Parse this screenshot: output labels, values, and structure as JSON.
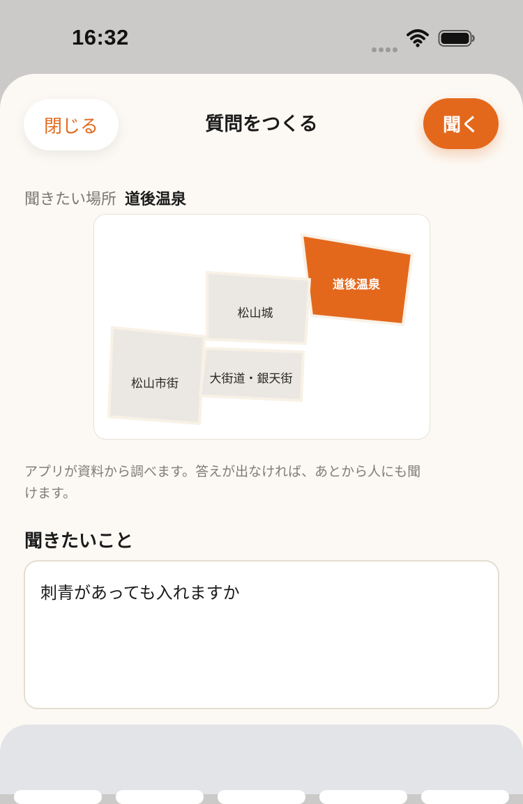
{
  "status": {
    "time": "16:32"
  },
  "header": {
    "close_label": "閉じる",
    "title": "質問をつくる",
    "ask_label": "聞く"
  },
  "place": {
    "label": "聞きたい場所",
    "value": "道後温泉"
  },
  "map": {
    "areas": [
      {
        "id": "dogo",
        "label": "道後温泉",
        "selected": true
      },
      {
        "id": "castle",
        "label": "松山城",
        "selected": false
      },
      {
        "id": "city",
        "label": "松山市街",
        "selected": false
      },
      {
        "id": "okaido",
        "label": "大街道・銀天街",
        "selected": false
      }
    ],
    "colors": {
      "selected": "#e4681c",
      "default": "#ebe8e3",
      "border": "#f8f1e6"
    }
  },
  "helper_text": "アプリが資料から調べます。答えが出なければ、あとから人にも聞けます。",
  "question": {
    "heading": "聞きたいこと",
    "value": "刺青があっても入れますか"
  },
  "theme": {
    "accent": "#e4681c",
    "sheet_bg": "#fcf9f4"
  }
}
